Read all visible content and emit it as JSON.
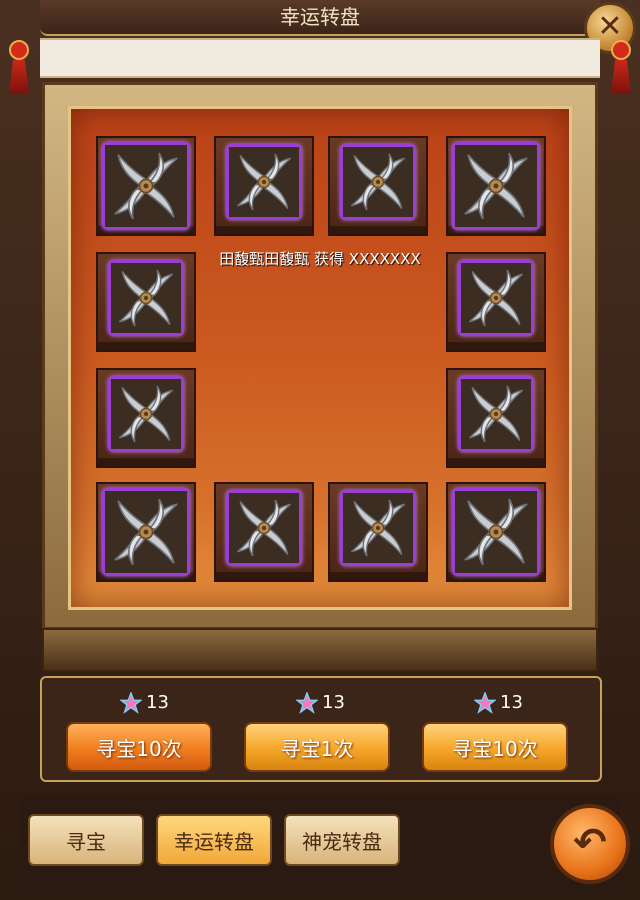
{
  "window": {
    "title": "幸运转盘",
    "close_icon": "close-icon"
  },
  "board": {
    "announcement": "田馥甄田馥甄 获得 XXXXXXX",
    "item_icon": "shuriken-icon",
    "item_border_color": "#9b3fd4",
    "slots": [
      {
        "id": "slot-1"
      },
      {
        "id": "slot-2"
      },
      {
        "id": "slot-3"
      },
      {
        "id": "slot-4"
      },
      {
        "id": "slot-5"
      },
      {
        "id": "slot-6"
      },
      {
        "id": "slot-7"
      },
      {
        "id": "slot-8"
      },
      {
        "id": "slot-9"
      },
      {
        "id": "slot-10"
      },
      {
        "id": "slot-11"
      },
      {
        "id": "slot-12"
      }
    ]
  },
  "actions": [
    {
      "cost": "13",
      "label": "寻宝10次",
      "style": "red"
    },
    {
      "cost": "13",
      "label": "寻宝1次",
      "style": "gold"
    },
    {
      "cost": "13",
      "label": "寻宝10次",
      "style": "gold"
    }
  ],
  "tabs": [
    {
      "label": "寻宝",
      "active": false
    },
    {
      "label": "幸运转盘",
      "active": true
    },
    {
      "label": "神宠转盘",
      "active": false
    }
  ],
  "back_icon": "back-arrow-icon",
  "colors": {
    "accent": "#f5a628",
    "board_red": "#cc5a20",
    "rarity_purple": "#9b3fd4"
  }
}
